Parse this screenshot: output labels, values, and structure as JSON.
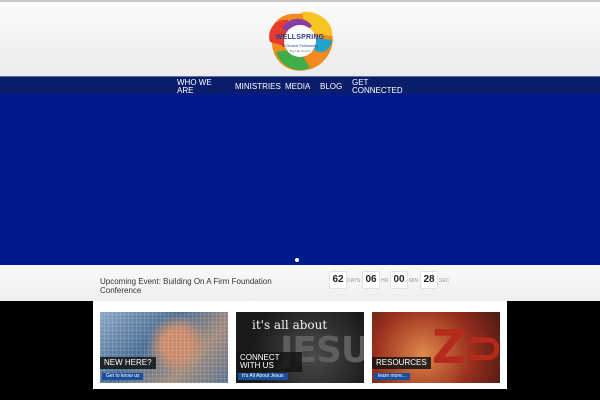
{
  "logo": {
    "name": "WELLSPRING",
    "tagline": "A Church Fellowship",
    "sub": "The Life Church"
  },
  "nav": {
    "items": [
      {
        "label": "WHO WE ARE"
      },
      {
        "label": "MINISTRIES"
      },
      {
        "label": "MEDIA"
      },
      {
        "label": "BLOG"
      },
      {
        "label": "GET CONNECTED"
      }
    ]
  },
  "event": {
    "title": "Upcoming Event: Building On A Firm Foundation Conference",
    "countdown": [
      {
        "value": "62",
        "unit": "DAYS"
      },
      {
        "value": "06",
        "unit": "HR"
      },
      {
        "value": "00",
        "unit": "MIN"
      },
      {
        "value": "28",
        "unit": "SEC"
      }
    ]
  },
  "cards": [
    {
      "title": "NEW HERE?",
      "button": "Get to know us"
    },
    {
      "title": "CONNECT WITH US",
      "button": "It's All About Jesus",
      "overlay": "it's all about",
      "overlay_big": "JESUS"
    },
    {
      "title": "RESOURCES",
      "button": "learn more..."
    }
  ],
  "colors": {
    "nav_bg": "#0a1d6b",
    "hero_bg": "#001a8b",
    "button": "#1a4f9c"
  }
}
